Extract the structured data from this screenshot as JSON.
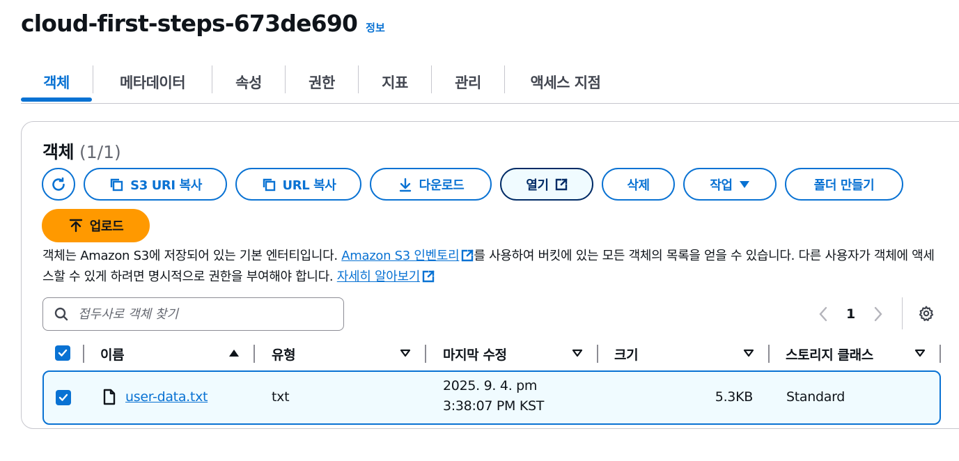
{
  "header": {
    "title": "cloud-first-steps-673de690",
    "info": "정보"
  },
  "tabs": [
    {
      "label": "객체",
      "active": true
    },
    {
      "label": "메타데이터"
    },
    {
      "label": "속성"
    },
    {
      "label": "권한"
    },
    {
      "label": "지표"
    },
    {
      "label": "관리"
    },
    {
      "label": "액세스 지점"
    }
  ],
  "panel": {
    "title": "객체",
    "count": "(1/1)"
  },
  "toolbar": {
    "copy_s3_uri": "S3 URI 복사",
    "copy_url": "URL 복사",
    "download": "다운로드",
    "open": "열기",
    "delete": "삭제",
    "actions": "작업",
    "create_folder": "폴더 만들기",
    "upload": "업로드"
  },
  "description": {
    "part1": "객체는 Amazon S3에 저장되어 있는 기본 엔터티입니다. ",
    "link1": "Amazon S3 인벤토리",
    "part2": "를 사용하여 버킷에 있는 모든 객체의 목록을 얻을 수 있습니다. 다른 사용자가 객체에 액세스할 수 있게 하려면 명시적으로 권한을 부여해야 합니다. ",
    "link2": "자세히 알아보기"
  },
  "search": {
    "placeholder": "접두사로 객체 찾기",
    "value": ""
  },
  "pagination": {
    "current_page": "1"
  },
  "table": {
    "columns": [
      "이름",
      "유형",
      "마지막 수정",
      "크기",
      "스토리지 클래스"
    ],
    "rows": [
      {
        "name": "user-data.txt",
        "type": "txt",
        "modified_line1": "2025. 9. 4. pm",
        "modified_line2": "3:38:07 PM KST",
        "size": "5.3KB",
        "storage_class": "Standard",
        "selected": true
      }
    ]
  },
  "colors": {
    "accent": "#0972d3",
    "primary_button": "#ff9900",
    "selected_row_bg": "#f0fbff"
  }
}
